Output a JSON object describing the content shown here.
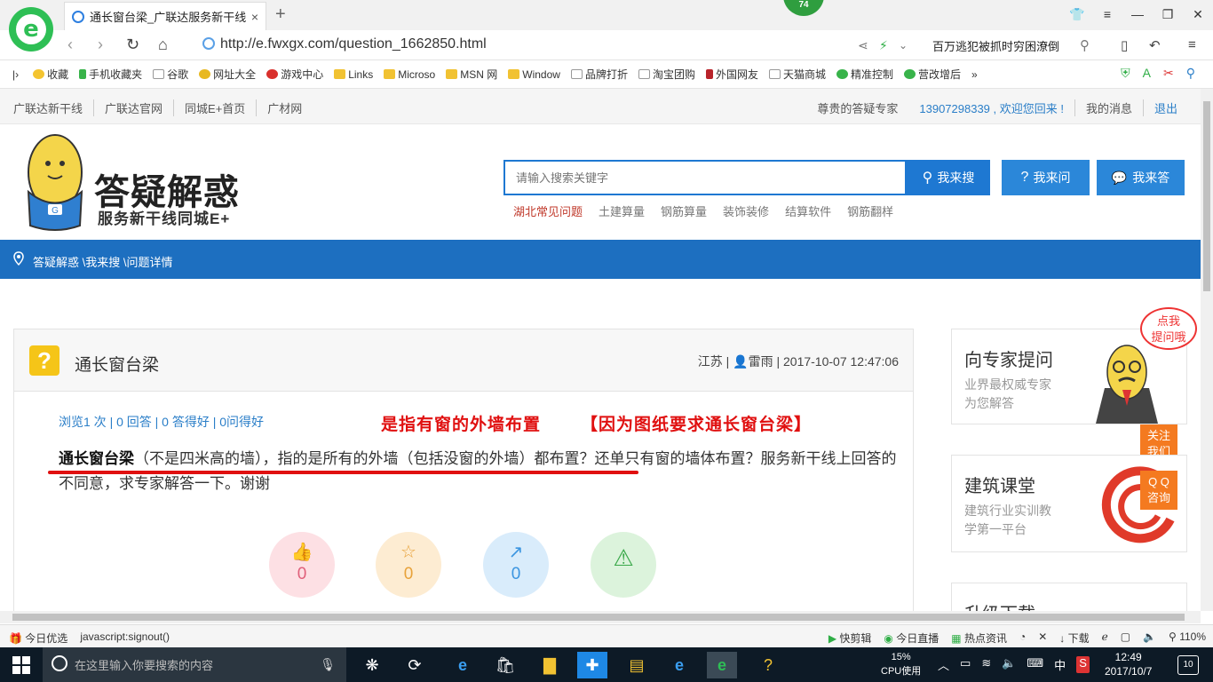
{
  "browser": {
    "tab_title": "通长窗台梁_广联达服务新干线",
    "tab_close": "×",
    "new_tab": "+",
    "badge_count": "74",
    "url": "http://e.fwxgx.com/question_1662850.html",
    "news_ticker": "百万逃犯被抓时穷困潦倒",
    "bookmarks": [
      "收藏",
      "手机收藏夹",
      "谷歌",
      "网址大全",
      "游戏中心",
      "Links",
      "Microso",
      "MSN 网",
      "Window",
      "品牌打折",
      "淘宝团购",
      "外国网友",
      "天猫商城",
      "精准控制",
      "营改增后"
    ],
    "bookmark_more": "»"
  },
  "topnav": {
    "left": [
      "广联达新干线",
      "广联达官网",
      "同城E+首页",
      "广材网"
    ],
    "greeting": "尊贵的答疑专家",
    "user": "13907298339 , 欢迎您回来 !",
    "messages": "我的消息",
    "logout": "退出"
  },
  "header": {
    "logo_title": "答疑解惑",
    "logo_subtitle": "服务新干线同城E+",
    "mascot_letter": "G",
    "search_placeholder": "请输入搜索关键字",
    "btn_search": "我来搜",
    "btn_ask": "我来问",
    "btn_answer": "我来答",
    "hot_links": [
      "湖北常见问题",
      "土建算量",
      "钢筋算量",
      "装饰装修",
      "结算软件",
      "钢筋翻样"
    ]
  },
  "breadcrumb": "答疑解惑 \\我来搜 \\问题详情",
  "question": {
    "icon": "?",
    "title": "通长窗台梁",
    "region": "江苏",
    "author": "雷雨",
    "datetime": "2017-10-07 12:47:06",
    "stats": "浏览1 次 | 0 回答 | 0 答得好 | 0问得好",
    "body_bold": "通长窗台梁",
    "body_rest": "（不是四米高的墙），指的是所有的外墙（包括没窗的外墙）都布置？还单只有窗的墙体布置？服务新干线上回答的不同意，求专家解答一下。谢谢",
    "annotation_1": "是指有窗的外墙布置",
    "annotation_2": "【因为图纸要求通长窗台梁】",
    "actions": [
      {
        "icon": "like-icon",
        "count": "0",
        "color": "#fde0e4",
        "fg": "#e0607a"
      },
      {
        "icon": "star-icon",
        "count": "0",
        "color": "#fdecd2",
        "fg": "#e8a23a"
      },
      {
        "icon": "share-icon",
        "count": "0",
        "color": "#d9ecfb",
        "fg": "#3b95e0"
      },
      {
        "icon": "report-icon",
        "count": "",
        "color": "#dcf3dc",
        "fg": "#3aa84a"
      }
    ]
  },
  "sidebar": {
    "box1_title": "向专家提问",
    "box1_sub1": "业界最权威专家",
    "box1_sub2": "为您解答",
    "box2_title": "建筑课堂",
    "box2_sub1": "建筑行业实训教",
    "box2_sub2": "学第一平台",
    "box3_title": "升级下载",
    "bubble": [
      "点我",
      "提问哦"
    ],
    "follow_btn": [
      "关注",
      "我们"
    ],
    "qq_btn": [
      "Q Q",
      "咨询"
    ]
  },
  "statusbar": {
    "left": [
      "今日优选",
      "javascript:signout()"
    ],
    "right": [
      "快剪辑",
      "今日直播",
      "热点资讯",
      "下载",
      "110%"
    ]
  },
  "taskbar": {
    "search_placeholder": "在这里输入你要搜索的内容",
    "cpu_pct": "15%",
    "cpu_label": "CPU使用",
    "ime": "中",
    "time": "12:49",
    "date": "2017/10/7",
    "notif": "10"
  }
}
